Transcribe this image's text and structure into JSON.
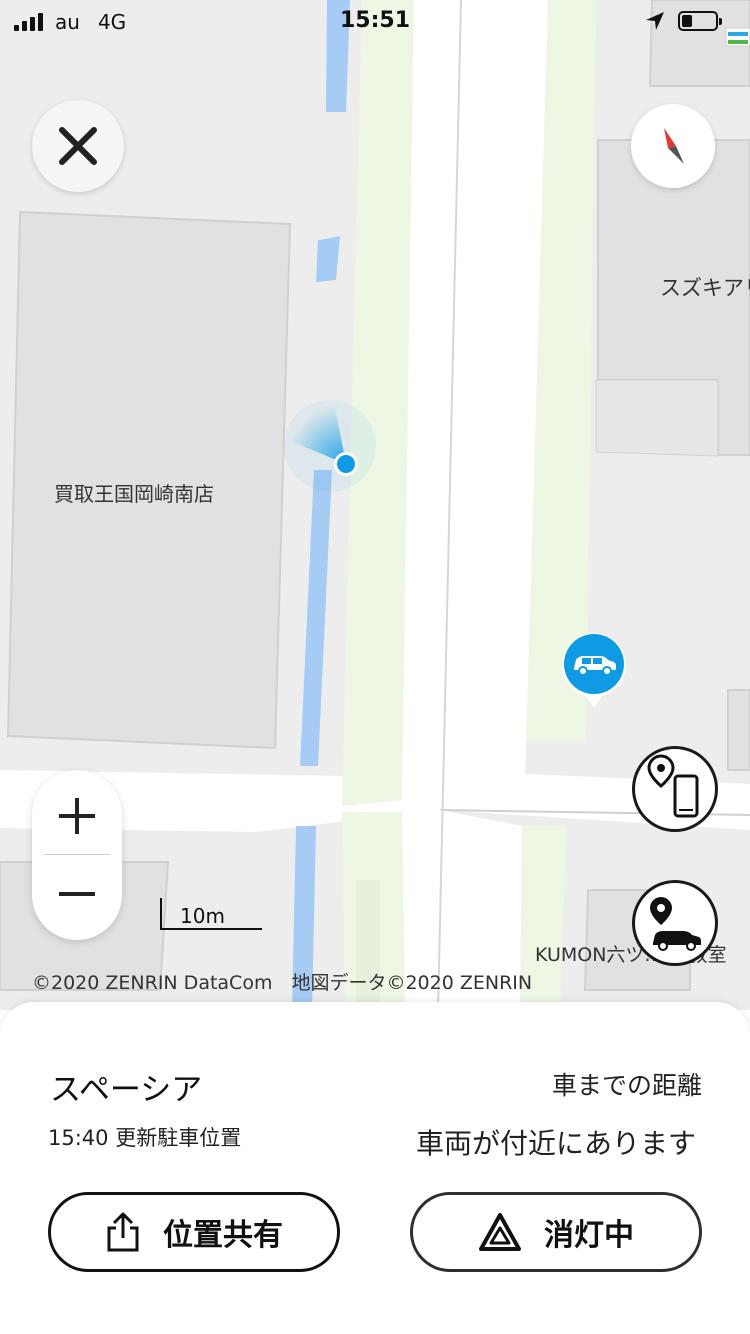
{
  "status_bar": {
    "carrier": "au",
    "network": "4G",
    "time": "15:51"
  },
  "map": {
    "labels": {
      "kaitori": "買取王国岡崎南店",
      "suzuki": "スズキアリ",
      "kumon": "KUMON六ツ… 部教室"
    },
    "scale_label": "10m",
    "copyright": "©2020 ZENRIN DataCom　地図データ©2020 ZENRIN",
    "colors": {
      "water": "#a6cbf5",
      "green_strip": "#eef6e4",
      "building": "#e2e2e2",
      "accent": "#0f9be3"
    }
  },
  "controls": {
    "close_icon": "close-icon",
    "compass_icon": "compass-icon",
    "zoom_in": "+",
    "zoom_out": "−"
  },
  "panel": {
    "vehicle_name": "スペーシア",
    "updated_text": "15:40 更新駐車位置",
    "distance_label": "車までの距離",
    "distance_value": "車両が付近にあります",
    "share_label": "位置共有",
    "hazard_label": "消灯中"
  }
}
